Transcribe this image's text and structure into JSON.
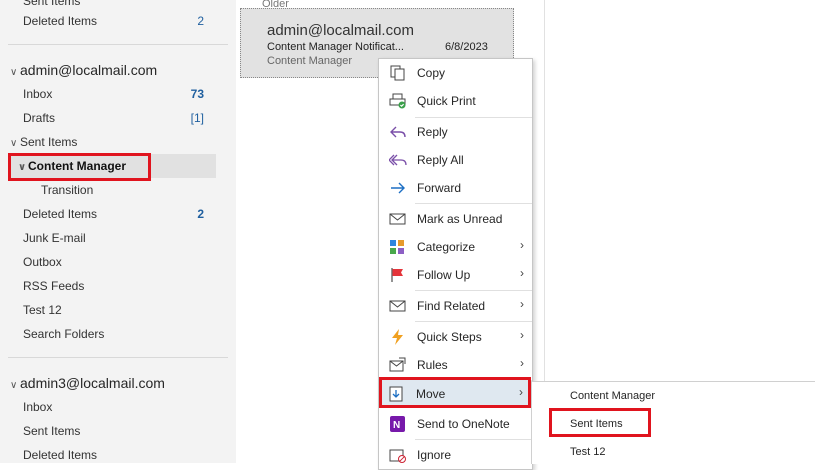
{
  "folders": {
    "top_partial": "Sent Items",
    "deleted_top": {
      "label": "Deleted Items",
      "count": "2"
    },
    "account1": {
      "name": "admin@localmail.com",
      "inbox": {
        "label": "Inbox",
        "count": "73"
      },
      "drafts": {
        "label": "Drafts",
        "count": "[1]"
      },
      "sent": "Sent Items",
      "content_manager": "Content Manager",
      "transition": "Transition",
      "deleted": {
        "label": "Deleted Items",
        "count": "2"
      },
      "junk": "Junk E-mail",
      "outbox": "Outbox",
      "rss": "RSS Feeds",
      "test12": "Test 12",
      "search": "Search Folders"
    },
    "account3": {
      "name": "admin3@localmail.com",
      "inbox": "Inbox",
      "sent": "Sent Items",
      "deleted": "Deleted Items"
    }
  },
  "message": {
    "sender": "admin@localmail.com",
    "subject": "Content Manager Notificat...",
    "date": "6/8/2023",
    "folder": "Content Manager",
    "top_partial": "Older"
  },
  "context_menu": {
    "copy": "Copy",
    "quick_print": "Quick Print",
    "reply": "Reply",
    "reply_all": "Reply All",
    "forward": "Forward",
    "mark_unread": "Mark as Unread",
    "categorize": "Categorize",
    "follow_up": "Follow Up",
    "find_related": "Find Related",
    "quick_steps": "Quick Steps",
    "rules": "Rules",
    "move": "Move",
    "onenote": "Send to OneNote",
    "ignore": "Ignore",
    "arrow": "›"
  },
  "submenu": {
    "content_manager": "Content Manager",
    "sent_items": "Sent Items",
    "test12": "Test 12"
  },
  "colors": {
    "highlight_box": "#e0141e",
    "count_blue": "#1f5f9f",
    "accent": "#0078d4"
  }
}
